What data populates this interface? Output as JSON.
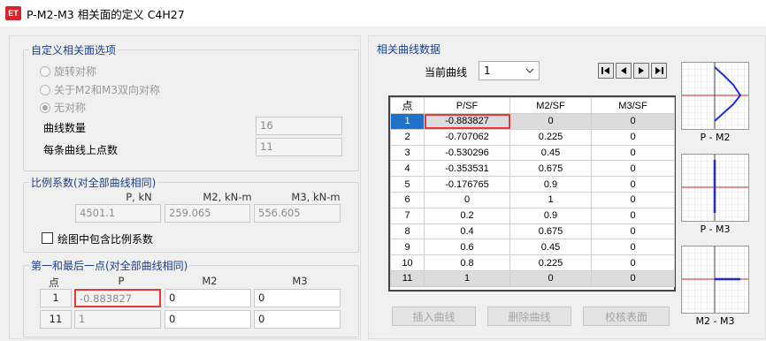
{
  "window": {
    "title": "P-M2-M3 相关面的定义 C4H27",
    "logo": "ET"
  },
  "options": {
    "legend": "自定义相关面选项",
    "radios": [
      {
        "label": "旋转对称",
        "checked": false
      },
      {
        "label": "关于M2和M3双向对称",
        "checked": false
      },
      {
        "label": "无对称",
        "checked": true
      }
    ],
    "curve_count_label": "曲线数量",
    "curve_count": "16",
    "points_per_curve_label": "每条曲线上点数",
    "points_per_curve": "11"
  },
  "scale": {
    "legend": "比例系数(对全部曲线相同)",
    "headers": [
      "P, kN",
      "M2, kN-m",
      "M3, kN-m"
    ],
    "values": [
      "4501.1",
      "259.065",
      "556.605"
    ],
    "include_label": "绘图中包含比例系数",
    "include_checked": false
  },
  "endpoints": {
    "legend": "第一和最后一点(对全部曲线相同)",
    "headers": [
      "点",
      "P",
      "M2",
      "M3"
    ],
    "rows": [
      {
        "point": "1",
        "P": "-0.883827",
        "M2": "0",
        "M3": "0"
      },
      {
        "point": "11",
        "P": "1",
        "M2": "0",
        "M3": "0"
      }
    ]
  },
  "curve_data": {
    "legend": "相关曲线数据",
    "current_label": "当前曲线",
    "current_value": "1",
    "nav_icons": [
      "first-icon",
      "prev-icon",
      "next-icon",
      "last-icon"
    ],
    "columns": [
      "点",
      "P/SF",
      "M2/SF",
      "M3/SF"
    ],
    "rows": [
      [
        "1",
        "-0.883827",
        "0",
        "0"
      ],
      [
        "2",
        "-0.707062",
        "0.225",
        "0"
      ],
      [
        "3",
        "-0.530296",
        "0.45",
        "0"
      ],
      [
        "4",
        "-0.353531",
        "0.675",
        "0"
      ],
      [
        "5",
        "-0.176765",
        "0.9",
        "0"
      ],
      [
        "6",
        "0",
        "1",
        "0"
      ],
      [
        "7",
        "0.2",
        "0.9",
        "0"
      ],
      [
        "8",
        "0.4",
        "0.675",
        "0"
      ],
      [
        "9",
        "0.6",
        "0.45",
        "0"
      ],
      [
        "10",
        "0.8",
        "0.225",
        "0"
      ],
      [
        "11",
        "1",
        "0",
        "0"
      ]
    ],
    "buttons": [
      "插入曲线",
      "删除曲线",
      "校核表面"
    ]
  },
  "previews": [
    {
      "caption": "P - M2"
    },
    {
      "caption": "P - M3"
    },
    {
      "caption": "M2 - M3"
    }
  ],
  "colors": {
    "legend_text": "#1a3f8f",
    "highlight": "#e53935",
    "selected_row": "#1e73c9",
    "curve": "#1f2fd6"
  }
}
